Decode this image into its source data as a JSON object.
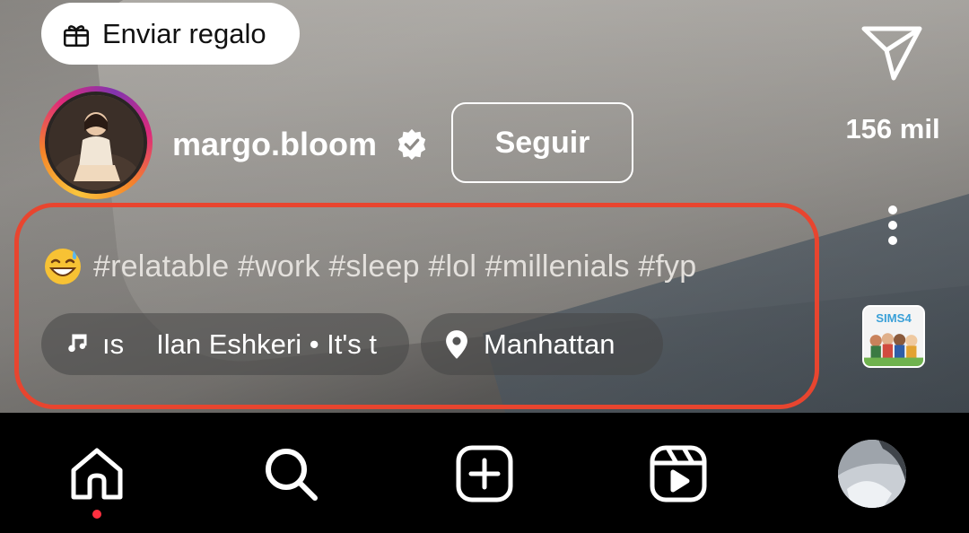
{
  "gift_button": {
    "label": "Enviar regalo",
    "icon": "gift-icon"
  },
  "sidebar": {
    "share_icon": "paper-plane-icon",
    "share_count": "156 mil",
    "more_icon": "vertical-ellipsis-icon",
    "audio_cover": {
      "text": "SIMS4"
    }
  },
  "profile": {
    "username": "margo.bloom",
    "verified_icon": "verified-badge-icon",
    "follow_label": "Seguir"
  },
  "caption": {
    "emoji": "😅",
    "text": "#relatable #work #sleep #lol #millenials #fyp"
  },
  "music": {
    "icon": "music-note-icon",
    "prefix": "ıs",
    "text": "Ilan Eshkeri • It's t"
  },
  "location": {
    "icon": "location-pin-icon",
    "label": "Manhattan"
  },
  "highlight_color": "#e8452f",
  "nav": {
    "items": [
      "home-icon",
      "search-icon",
      "create-icon",
      "reels-icon",
      "profile-avatar"
    ],
    "active": "home",
    "notification_color": "#ff3040"
  }
}
